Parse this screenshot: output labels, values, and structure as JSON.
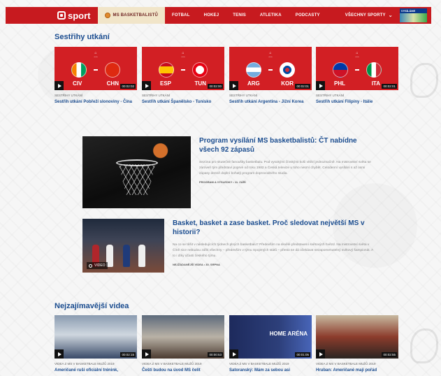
{
  "nav": {
    "logo": "sport",
    "items": [
      {
        "label": "MS BASKETBALISTŮ",
        "active": true
      },
      {
        "label": "FOTBAL"
      },
      {
        "label": "HOKEJ"
      },
      {
        "label": "TENIS"
      },
      {
        "label": "ATLETIKA"
      },
      {
        "label": "PODCASTY"
      },
      {
        "label": "VŠECHNY SPORTY"
      }
    ],
    "live_label": "VYSÍLÁME"
  },
  "highlights": {
    "title": "Sestřihy utkání",
    "cards": [
      {
        "left": "CIV",
        "right": "CHN",
        "duration": "00:02:02",
        "meta": "SESTŘIHY UTKÁNÍ",
        "title": "Sestřih utkání Pobřeží slonoviny - Čína"
      },
      {
        "left": "ESP",
        "right": "TUN",
        "duration": "00:02:00",
        "meta": "SESTŘIHY UTKÁNÍ",
        "title": "Sestřih utkání Španělsko - Tunisko"
      },
      {
        "left": "ARG",
        "right": "KOR",
        "duration": "00:02:01",
        "meta": "SESTŘIHY UTKÁNÍ",
        "title": "Sestřih utkání Argentina - Jižní Korea"
      },
      {
        "left": "PHL",
        "right": "ITA",
        "duration": "00:02:01",
        "meta": "SESTŘIHY UTKÁNÍ",
        "title": "Sestřih utkání Filipíny - Itálie"
      }
    ]
  },
  "articles": [
    {
      "title": "Program vysílání MS basketbalistů: ČT nabídne všech 92 zápasů",
      "desc": "Sezóna pro skutečné fanoušky basketbalu. Pod vysokými čínskými koši vítězí jednoznačně. Na mistrovství světa se zároveň tým představí poprvé od roku 1982 a Česká televize u toho nesmí chybět. Celodenní vysílání s až osmi zápasy denně doplní bohatý program doprovodného studia.",
      "meta": "PROGRAM A VÝSLEDKY • 11. ZÁŘÍ"
    },
    {
      "title": "Basket, basket a zase basket. Proč sledovat největší MS v historii?",
      "desc": "Na co se těšit v následujících týdnech plných basketbalu? Především na skvělé představení světových hvězd. Na mistrovství světa v Číně sice nebudou zářiti všechny – především v týmu Spojených států – přesto se dá očekávat nezapomenutelný světový šampionát. A to i díky účasti českého týmu.",
      "meta": "NEJŽÁDANĚJŠÍ VIDEA • 30. SRPNA",
      "badge": "VIDEO"
    }
  ],
  "videos": {
    "title": "Nejzajímavější videa",
    "cards": [
      {
        "duration": "00:02:15",
        "meta": "VIDEA Z MS V BASKETBALE MUŽŮ 2019",
        "title": "Američané ruší oficiální trénink,"
      },
      {
        "duration": "00:00:53",
        "meta": "VIDEA Z MS V BASKETBALE MUŽŮ 2019",
        "title": "Čeští budou na úvod MS čelit"
      },
      {
        "duration": "00:01:05",
        "meta": "VIDEA Z MS V BASKETBALE MUŽŮ 2019",
        "title": "Satoranský: Mám za sebou asi",
        "overlay": "HOME ARÉNA"
      },
      {
        "duration": "00:02:55",
        "meta": "VIDEA Z MS V BASKETBALE MUŽŮ 2019",
        "title": "Hruban: Američané mají pořád"
      }
    ]
  },
  "colors": {
    "brand": "#c71a1f",
    "link": "#1a4c8f"
  }
}
